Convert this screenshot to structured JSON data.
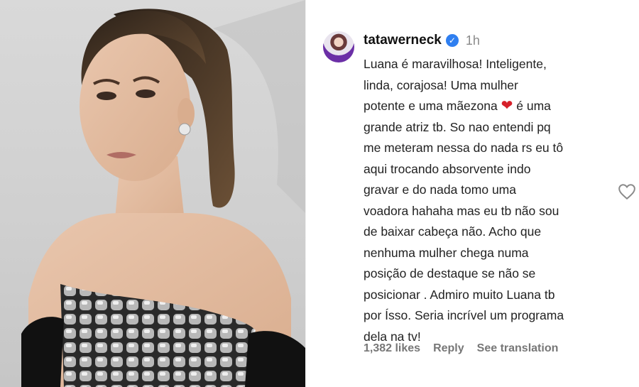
{
  "comment": {
    "username": "tatawerneck",
    "time": "1h",
    "lines": [
      "Luana é maravilhosa! Inteligente,",
      "linda, corajosa! Uma mulher",
      "potente e uma mãezona",
      "grande atriz tb. So nao entendi pq",
      "me meteram nessa do nada rs eu tô",
      "aqui trocando absorvente indo",
      "gravar e do nada tomo uma",
      "voadora hahaha mas eu tb não sou",
      "de baixar cabeça não. Acho que",
      "nenhuma mulher chega numa",
      "posição de destaque se não se",
      "posicionar . Admiro muito Luana tb",
      "por Ísso. Seria incrível um programa",
      "dela na tv!"
    ],
    "line3_suffix": " é uma",
    "heart_emoji": "❤",
    "likes": "1,382 likes",
    "reply": "Reply",
    "see_translation": "See translation"
  },
  "icons": {
    "verified": "verified-check-icon",
    "like": "heart-outline-icon"
  },
  "colors": {
    "verified": "#2f7ff0",
    "heart": "#d6202a"
  }
}
